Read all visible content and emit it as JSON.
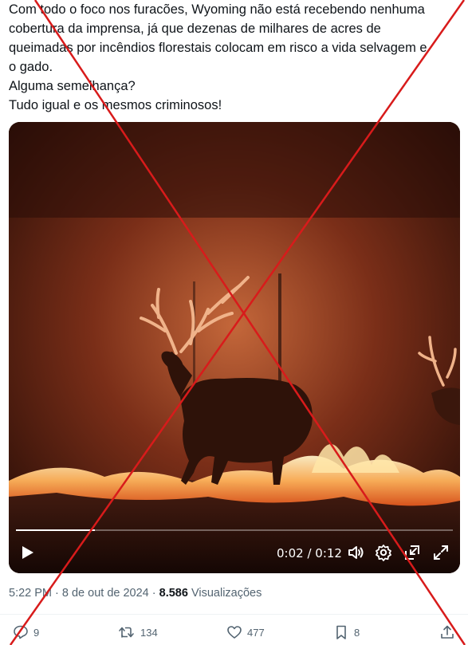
{
  "tweet": {
    "lines": [
      "Com todo o foco nos furacões, Wyoming não está recebendo nenhuma",
      "cobertura da imprensa, já que dezenas de milhares de acres de",
      "queimadas por incêndios florestais colocam em risco a vida selvagem e",
      "o gado.",
      "Alguma semelhança?",
      "Tudo igual e os mesmos criminosos!"
    ]
  },
  "video": {
    "time_display": "0:02 / 0:12",
    "progress": 0.18,
    "icons": {
      "play": "play-icon",
      "volume": "volume-icon",
      "settings": "gear-icon",
      "pip": "picture-in-picture-icon",
      "fullscreen": "fullscreen-icon"
    }
  },
  "meta": {
    "time": "5:22 PM",
    "separator1": " · ",
    "date": "8 de out de 2024",
    "separator2": " · ",
    "views_count": "8.586",
    "views_label": " Visualizações"
  },
  "actions": {
    "replies": "9",
    "reposts": "134",
    "likes": "477",
    "bookmarks": "8"
  },
  "colors": {
    "cross": "#d81b1b",
    "text": "#0f1419",
    "muted": "#536471"
  }
}
